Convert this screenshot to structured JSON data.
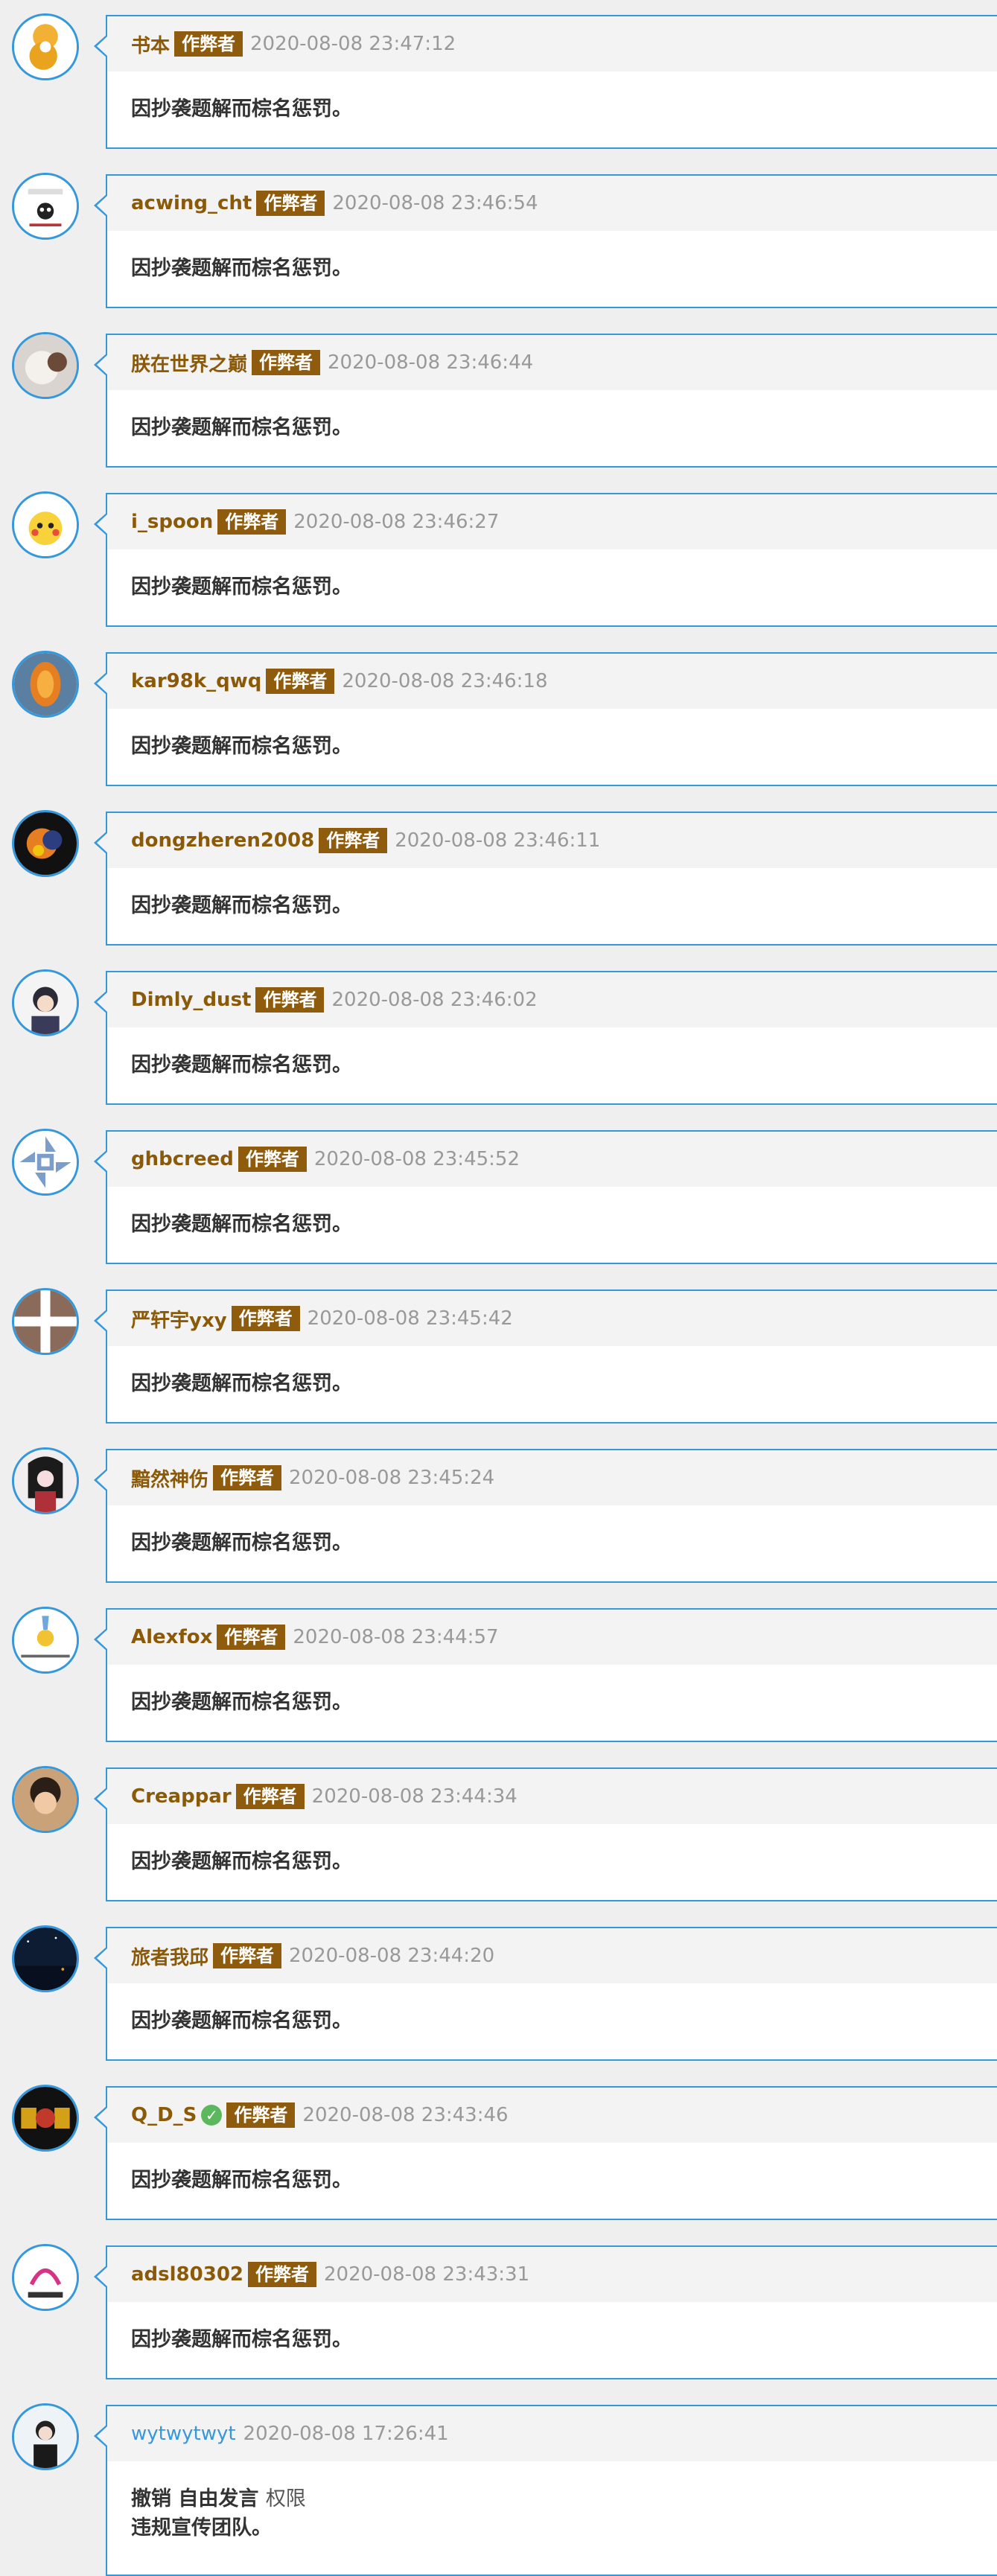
{
  "badge_label": "作弊者",
  "penalty_text": "因抄袭题解而棕名惩罚。",
  "comments": [
    {
      "user": "书本",
      "time": "2020-08-08 23:47:12"
    },
    {
      "user": "acwing_cht",
      "time": "2020-08-08 23:46:54"
    },
    {
      "user": "朕在世界之巅",
      "time": "2020-08-08 23:46:44"
    },
    {
      "user": "i_spoon",
      "time": "2020-08-08 23:46:27"
    },
    {
      "user": "kar98k_qwq",
      "time": "2020-08-08 23:46:18"
    },
    {
      "user": "dongzheren2008",
      "time": "2020-08-08 23:46:11"
    },
    {
      "user": "Dimly_dust",
      "time": "2020-08-08 23:46:02"
    },
    {
      "user": "ghbcreed",
      "time": "2020-08-08 23:45:52"
    },
    {
      "user": "严轩宇yxy",
      "time": "2020-08-08 23:45:42"
    },
    {
      "user": "黯然神伤",
      "time": "2020-08-08 23:45:24"
    },
    {
      "user": "Alexfox",
      "time": "2020-08-08 23:44:57"
    },
    {
      "user": "Creappar",
      "time": "2020-08-08 23:44:34"
    },
    {
      "user": "旅者我邱",
      "time": "2020-08-08 23:44:20"
    },
    {
      "user": "Q_D_S",
      "time": "2020-08-08 23:43:46",
      "verified": true
    },
    {
      "user": "adsl80302",
      "time": "2020-08-08 23:43:31"
    }
  ],
  "last_comment": {
    "user": "wytwytwyt",
    "time": "2020-08-08 17:26:41",
    "line1_revoke": "撤销",
    "line1_freespeech": "自由发言",
    "line1_perm": "权限",
    "line2": "违规宣传团队。"
  },
  "colors": {
    "accent": "#3498db",
    "brown_name": "#8b5a09",
    "badge_bg": "#8e5c0c",
    "verified": "#5cb85c"
  },
  "icons": {
    "verified": "check-circle-icon"
  }
}
